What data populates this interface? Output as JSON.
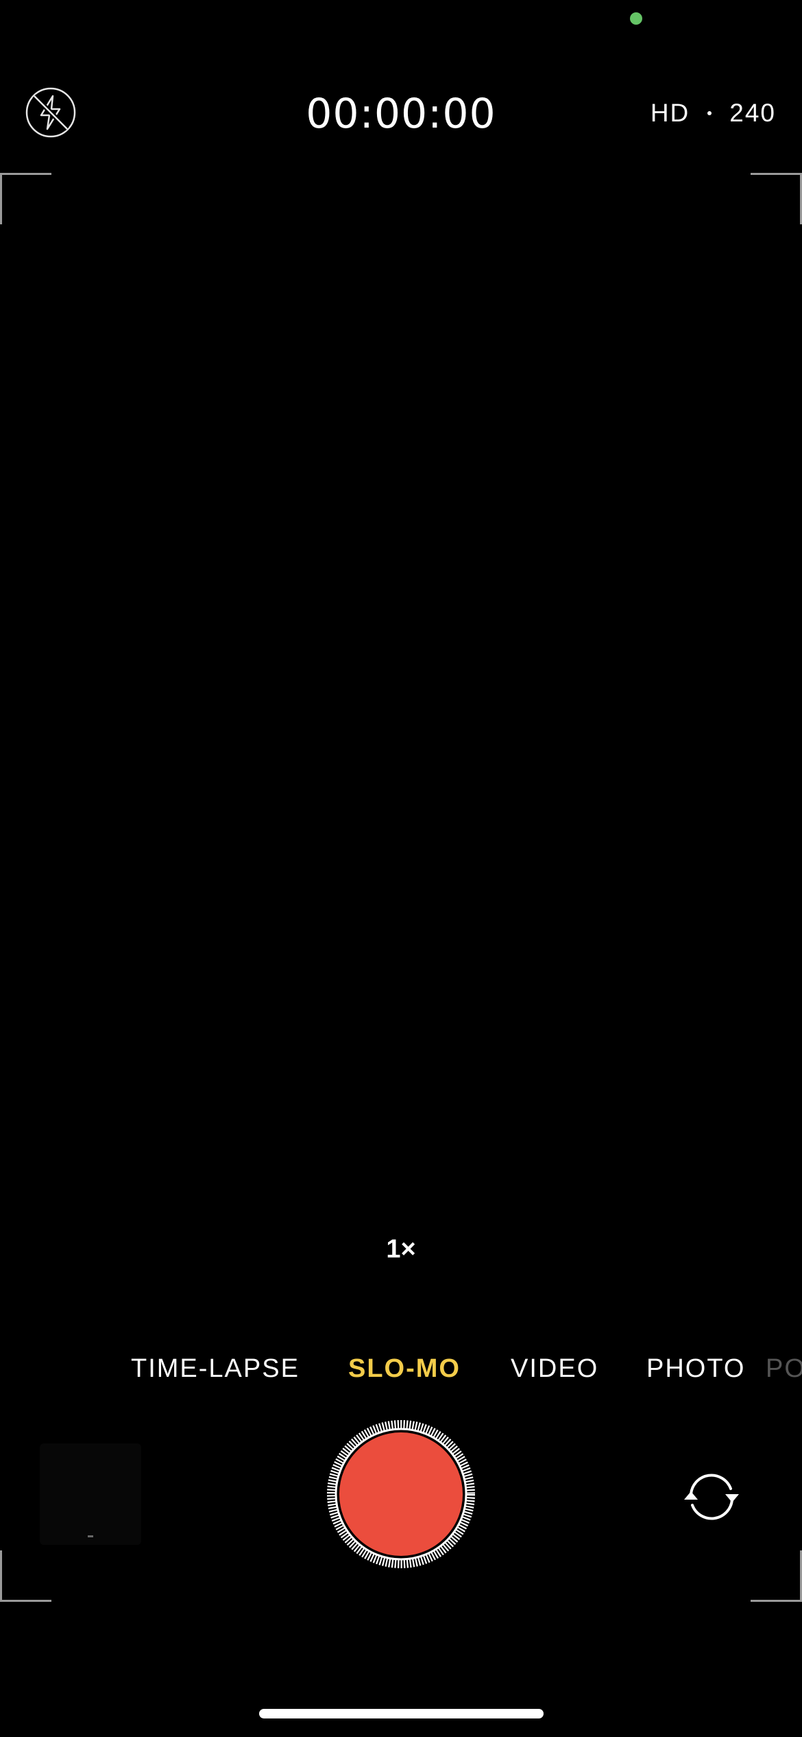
{
  "status": {
    "privacy_indicator_color": "#65c466"
  },
  "top_bar": {
    "flash_icon": "flash-off-icon",
    "timer": "00:00:00",
    "resolution": "HD",
    "frame_rate": "240"
  },
  "viewfinder": {
    "zoom_label": "1×"
  },
  "modes": {
    "items": [
      {
        "label": "TIME-LAPSE"
      },
      {
        "label": "SLO-MO",
        "selected": true
      },
      {
        "label": "VIDEO"
      },
      {
        "label": "PHOTO"
      },
      {
        "label": "PO"
      }
    ],
    "selected_color": "#f3cc4a"
  },
  "bottom_bar": {
    "shutter_color": "#eb4d3d",
    "flip_icon": "camera-flip-icon",
    "thumbnail_icon": "last-capture-thumbnail"
  }
}
